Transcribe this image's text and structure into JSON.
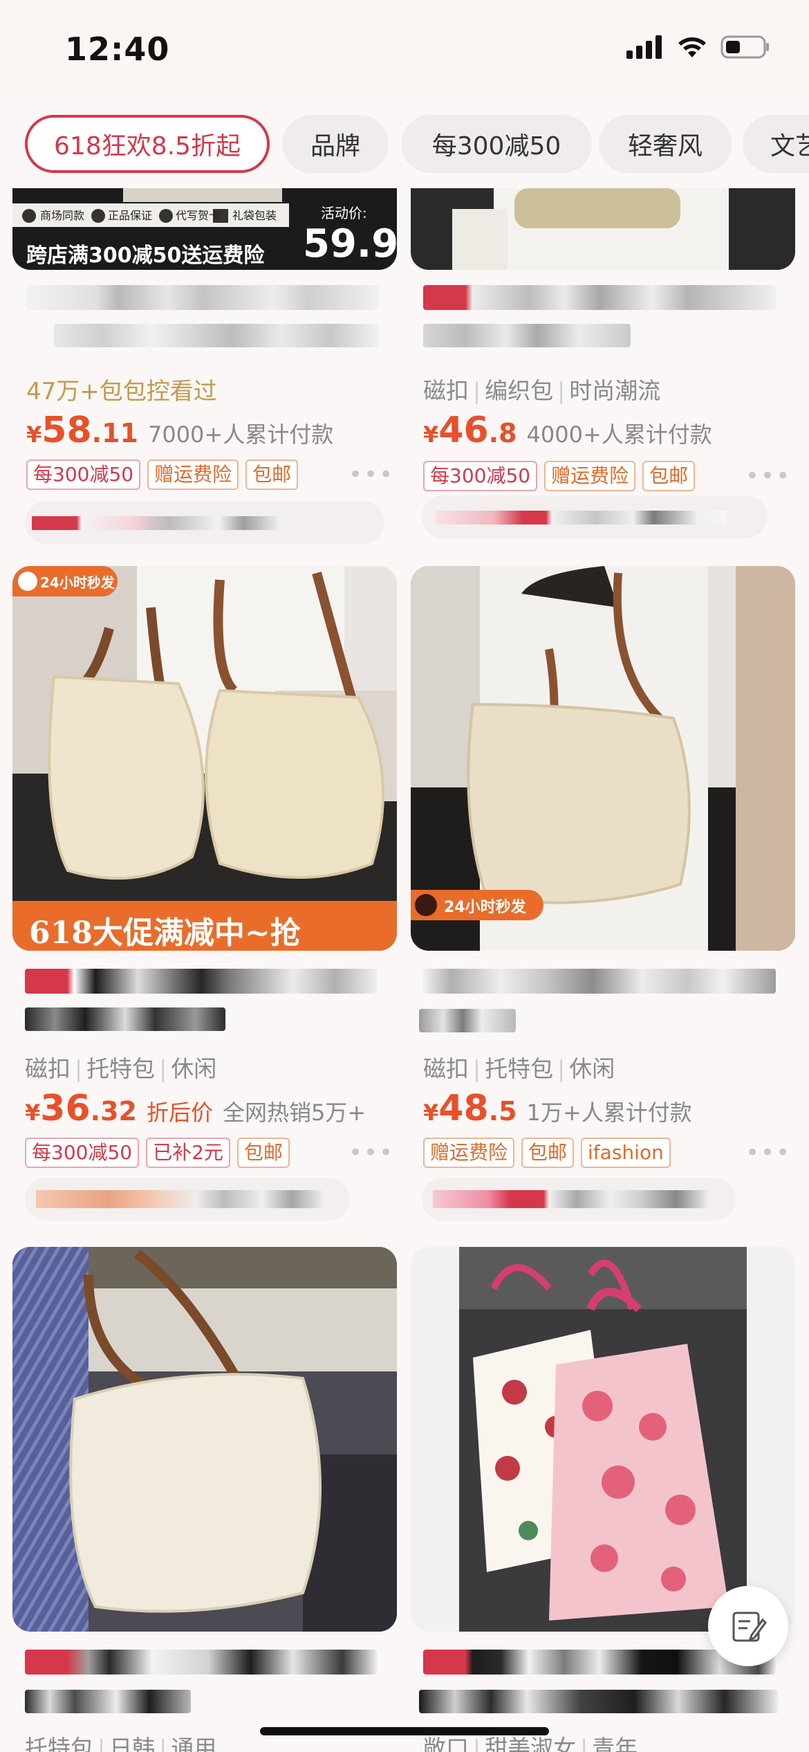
{
  "status_bar": {
    "time": "12:40"
  },
  "filters": [
    {
      "label": "618狂欢8.5折起",
      "active": true
    },
    {
      "label": "品牌"
    },
    {
      "label": "每300减50"
    },
    {
      "label": "轻奢风"
    },
    {
      "label": "文艺"
    }
  ],
  "products": [
    {
      "banner_text": "跨店满300减50送运费险",
      "banner_price_label": "活动价:",
      "banner_price": "59.9",
      "banner_tags": [
        "商场同款",
        "正品保证",
        "代写贺卡",
        "礼袋包装"
      ],
      "seen": "47万+包包控看过",
      "price_int": "58",
      "price_dec": ".11",
      "sales": "7000+人累计付款",
      "badges": [
        "每300减50",
        "赠运费险",
        "包邮"
      ]
    },
    {
      "tags": [
        "磁扣",
        "编织包",
        "时尚潮流"
      ],
      "price_int": "46",
      "price_dec": ".8",
      "sales": "4000+人累计付款",
      "badges": [
        "每300减50",
        "赠运费险",
        "包邮"
      ]
    },
    {
      "corner_badge": "24小时秒发",
      "promo_banner": "618大促满减中~抢",
      "tags": [
        "磁扣",
        "托特包",
        "休闲"
      ],
      "price_int": "36",
      "price_dec": ".32",
      "after_price": "折后价",
      "sales": "全网热销5万+",
      "badges": [
        "每300减50",
        "已补2元",
        "包邮"
      ]
    },
    {
      "corner_badge": "24小时秒发",
      "tags": [
        "磁扣",
        "托特包",
        "休闲"
      ],
      "price_int": "48",
      "price_dec": ".5",
      "sales": "1万+人累计付款",
      "badges": [
        "赠运费险",
        "包邮",
        "ifashion"
      ]
    },
    {
      "tags": [
        "托特包",
        "日韩",
        "通用"
      ]
    },
    {
      "tags": [
        "敞口",
        "甜美淑女",
        "青年"
      ]
    }
  ],
  "currency": "¥",
  "more_label": "•••",
  "colors": {
    "accent": "#d5384a",
    "price": "#e8502a",
    "seen": "#c39a4e"
  }
}
